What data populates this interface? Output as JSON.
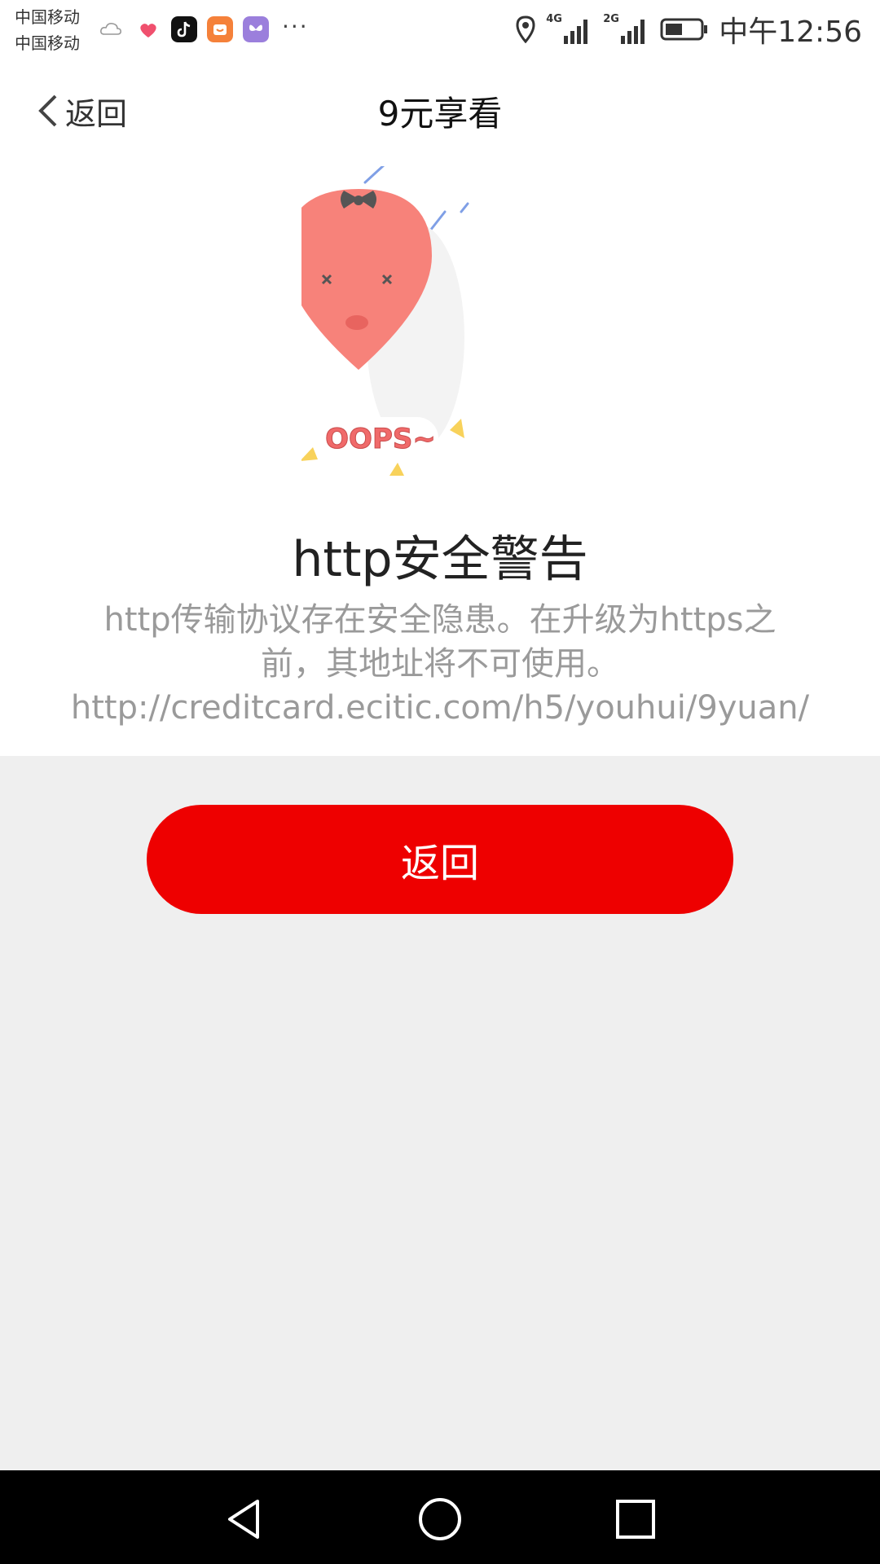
{
  "status_bar": {
    "carrier_1": "中国移动",
    "carrier_2": "中国移动",
    "network_1": "4G",
    "network_2": "2G",
    "time": "中午12:56",
    "more": "···",
    "icons": [
      "cloud-icon",
      "heart-app-icon",
      "tiktok-icon",
      "shopping-app-icon",
      "butterfly-app-icon"
    ]
  },
  "nav": {
    "back_label": "返回",
    "title": "9元享看"
  },
  "illustration": {
    "text": "OOPS~"
  },
  "warning": {
    "title": "http安全警告",
    "line1": "http传输协议存在安全隐患。在升级为https之",
    "line2": "前，其地址将不可使用。",
    "url": "http://creditcard.ecitic.com/h5/youhui/9yuan/"
  },
  "button": {
    "label": "返回",
    "color": "#ee0000"
  }
}
